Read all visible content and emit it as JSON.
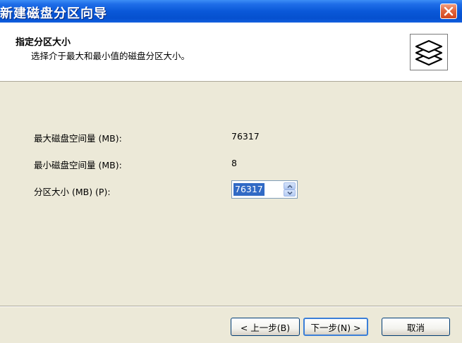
{
  "window": {
    "title": "新建磁盘分区向导",
    "close_icon": "close-icon"
  },
  "header": {
    "title": "指定分区大小",
    "subtitle": "选择介于最大和最小值的磁盘分区大小。",
    "icon": "disk-stack-icon"
  },
  "form": {
    "max_label": "最大磁盘空间量 (MB):",
    "max_value": "76317",
    "min_label": "最小磁盘空间量 (MB):",
    "min_value": "8",
    "size_label": "分区大小 (MB) (P):",
    "size_value": "76317"
  },
  "buttons": {
    "back": "< 上一步(B)",
    "next": "下一步(N) >",
    "cancel": "取消"
  },
  "colors": {
    "titlebar": "#0a58d8",
    "selection": "#316ac5",
    "dialog_bg": "#ece9d8"
  }
}
